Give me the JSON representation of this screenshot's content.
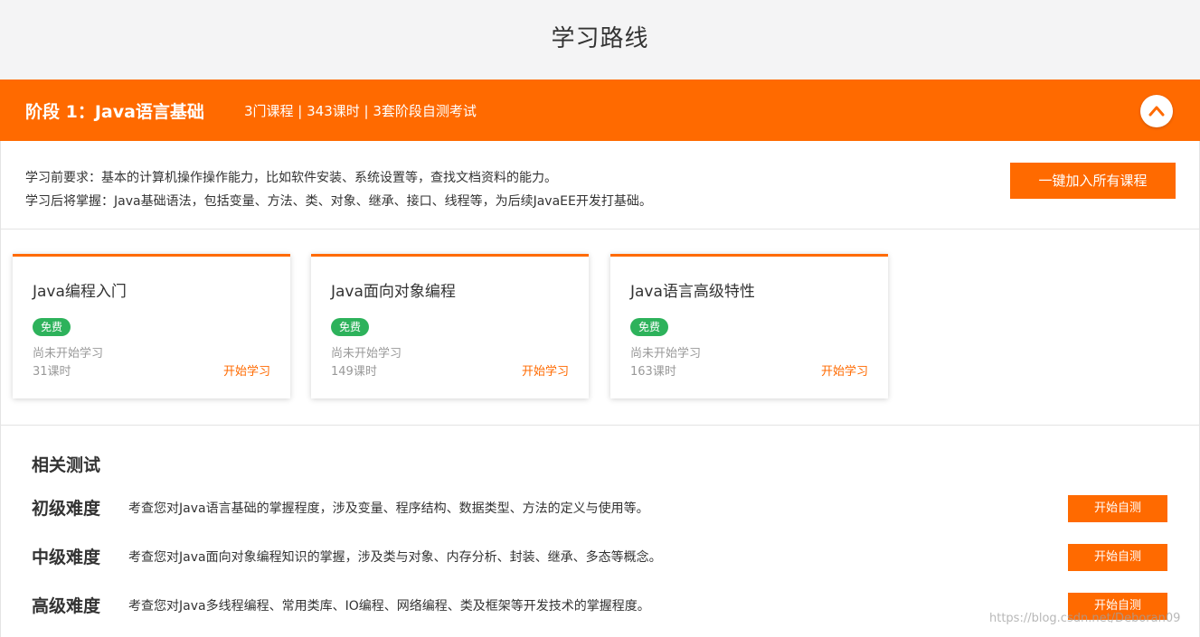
{
  "page_title": "学习路线",
  "stage": {
    "title": "阶段 1：Java语言基础",
    "meta": "3门课程 | 343课时 | 3套阶段自测考试",
    "collapse_icon": "chevron-up-icon",
    "prerequisite": "学习前要求：基本的计算机操作操作能力，比如软件安装、系统设置等，查找文档资料的能力。",
    "outcome": "学习后将掌握：Java基础语法，包括变量、方法、类、对象、继承、接口、线程等，为后续JavaEE开发打基础。",
    "join_all_label": "一键加入所有课程"
  },
  "courses": [
    {
      "name": "Java编程入门",
      "badge": "免费",
      "status": "尚未开始学习",
      "hours": "31课时",
      "action": "开始学习"
    },
    {
      "name": "Java面向对象编程",
      "badge": "免费",
      "status": "尚未开始学习",
      "hours": "149课时",
      "action": "开始学习"
    },
    {
      "name": "Java语言高级特性",
      "badge": "免费",
      "status": "尚未开始学习",
      "hours": "163课时",
      "action": "开始学习"
    }
  ],
  "tests": {
    "heading": "相关测试",
    "items": [
      {
        "level": "初级难度",
        "desc": "考查您对Java语言基础的掌握程度，涉及变量、程序结构、数据类型、方法的定义与使用等。",
        "button": "开始自测"
      },
      {
        "level": "中级难度",
        "desc": "考查您对Java面向对象编程知识的掌握，涉及类与对象、内存分析、封装、继承、多态等概念。",
        "button": "开始自测"
      },
      {
        "level": "高级难度",
        "desc": "考查您对Java多线程编程、常用类库、IO编程、网络编程、类及框架等开发技术的掌握程度。",
        "button": "开始自测"
      }
    ]
  },
  "watermark": "https://blog.csdn.net/Deboran09",
  "colors": {
    "accent": "#ff6a00",
    "badge_green": "#2db25b"
  }
}
